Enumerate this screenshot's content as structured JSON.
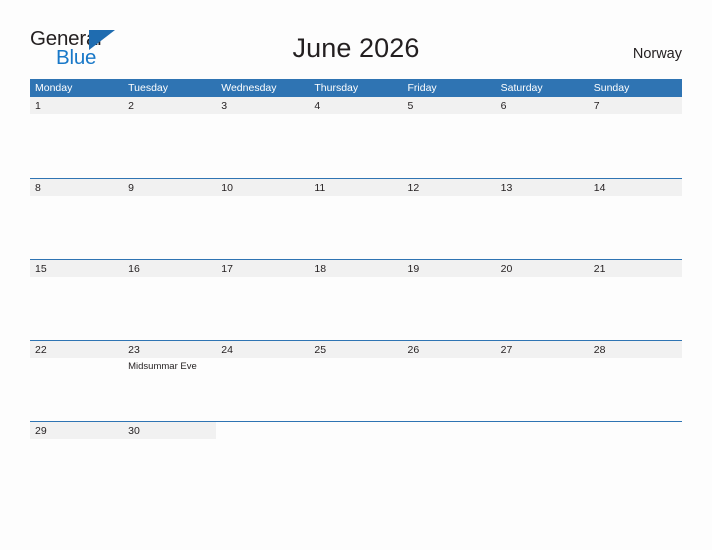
{
  "brand": {
    "name_top": "General",
    "name_bottom": "Blue",
    "flag_icon": "triangle-flag-icon",
    "color_dark": "#231f20",
    "color_blue": "#1878c8"
  },
  "header": {
    "title": "June 2026",
    "country": "Norway"
  },
  "theme": {
    "header_blue": "#2f74b3",
    "date_strip_gray": "#f1f1f1",
    "page_background": "#fdfdfd",
    "text_dark": "#231f20"
  },
  "calendar": {
    "weekdays": [
      "Monday",
      "Tuesday",
      "Wednesday",
      "Thursday",
      "Friday",
      "Saturday",
      "Sunday"
    ],
    "weeks": [
      {
        "days": [
          {
            "number": "1",
            "events": []
          },
          {
            "number": "2",
            "events": []
          },
          {
            "number": "3",
            "events": []
          },
          {
            "number": "4",
            "events": []
          },
          {
            "number": "5",
            "events": []
          },
          {
            "number": "6",
            "events": []
          },
          {
            "number": "7",
            "events": []
          }
        ]
      },
      {
        "days": [
          {
            "number": "8",
            "events": []
          },
          {
            "number": "9",
            "events": []
          },
          {
            "number": "10",
            "events": []
          },
          {
            "number": "11",
            "events": []
          },
          {
            "number": "12",
            "events": []
          },
          {
            "number": "13",
            "events": []
          },
          {
            "number": "14",
            "events": []
          }
        ]
      },
      {
        "days": [
          {
            "number": "15",
            "events": []
          },
          {
            "number": "16",
            "events": []
          },
          {
            "number": "17",
            "events": []
          },
          {
            "number": "18",
            "events": []
          },
          {
            "number": "19",
            "events": []
          },
          {
            "number": "20",
            "events": []
          },
          {
            "number": "21",
            "events": []
          }
        ]
      },
      {
        "days": [
          {
            "number": "22",
            "events": []
          },
          {
            "number": "23",
            "events": [
              "Midsummar Eve"
            ]
          },
          {
            "number": "24",
            "events": []
          },
          {
            "number": "25",
            "events": []
          },
          {
            "number": "26",
            "events": []
          },
          {
            "number": "27",
            "events": []
          },
          {
            "number": "28",
            "events": []
          }
        ]
      },
      {
        "days": [
          {
            "number": "29",
            "events": []
          },
          {
            "number": "30",
            "events": []
          },
          {
            "number": "",
            "events": []
          },
          {
            "number": "",
            "events": []
          },
          {
            "number": "",
            "events": []
          },
          {
            "number": "",
            "events": []
          },
          {
            "number": "",
            "events": []
          }
        ]
      }
    ]
  }
}
